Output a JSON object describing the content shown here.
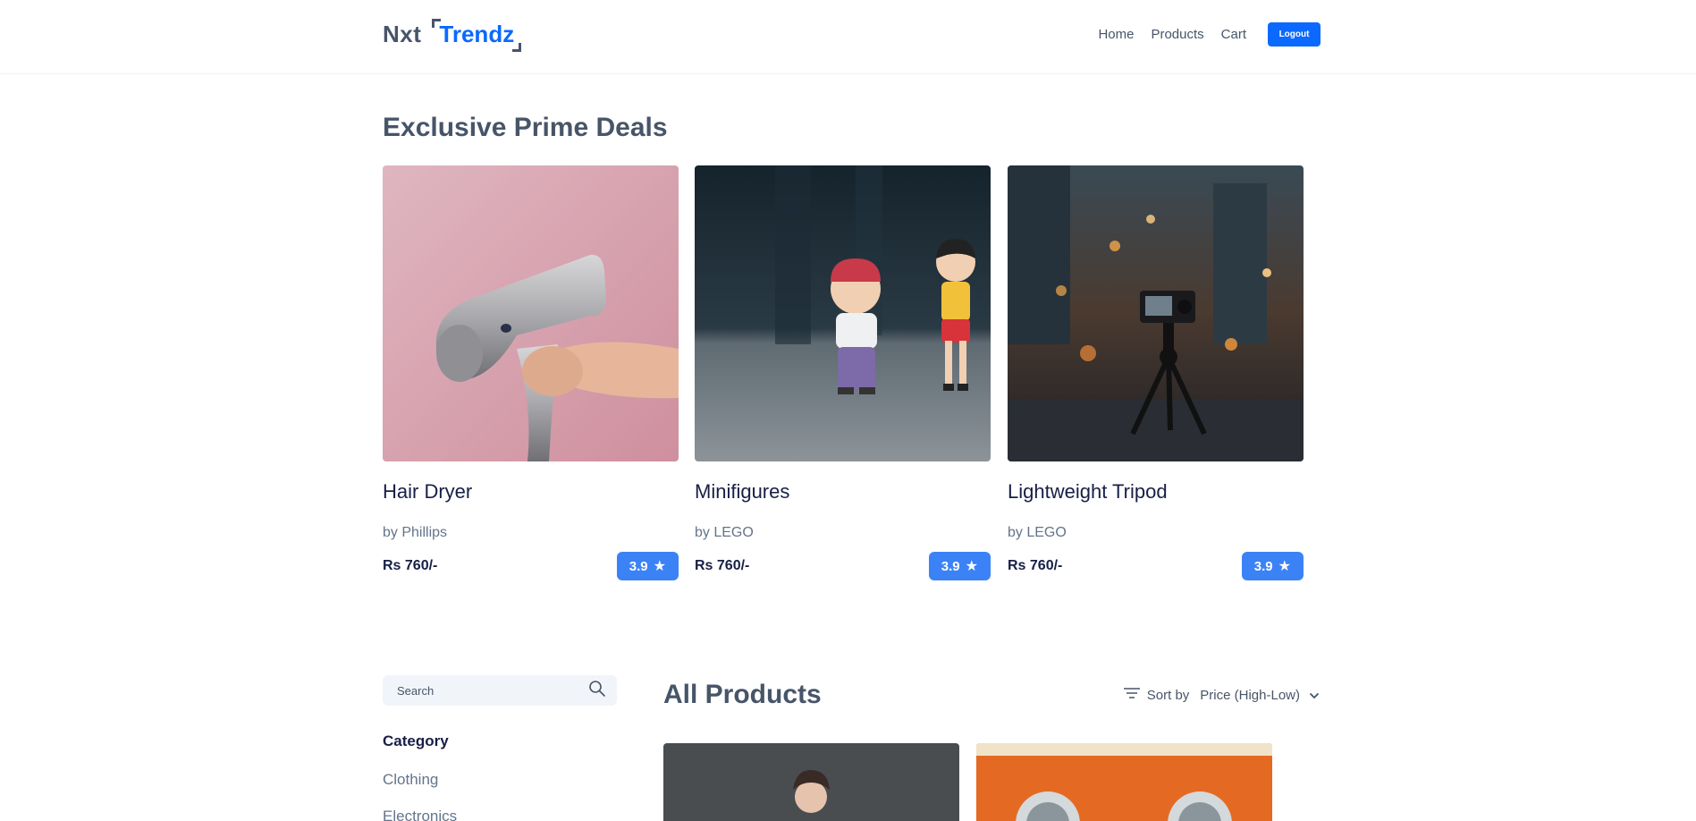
{
  "header": {
    "logo_part1": "Nxt",
    "logo_part2": "Trendz",
    "nav": [
      "Home",
      "Products",
      "Cart"
    ],
    "logout_label": "Logout"
  },
  "prime": {
    "title": "Exclusive Prime Deals",
    "deals": [
      {
        "name": "Hair Dryer",
        "brand": "by Phillips",
        "price": "Rs 760/-",
        "rating": "3.9"
      },
      {
        "name": "Minifigures",
        "brand": "by LEGO",
        "price": "Rs 760/-",
        "rating": "3.9"
      },
      {
        "name": "Lightweight Tripod",
        "brand": "by LEGO",
        "price": "Rs 760/-",
        "rating": "3.9"
      }
    ]
  },
  "filters": {
    "search_placeholder": "Search",
    "category_heading": "Category",
    "categories": [
      "Clothing",
      "Electronics"
    ]
  },
  "products": {
    "title": "All Products",
    "sort_label": "Sort by",
    "sort_value": "Price (High-Low)"
  },
  "colors": {
    "brand_blue": "#0b69ff",
    "rating_blue": "#3b82f6",
    "heading_gray": "#475569"
  },
  "icons": {
    "rating": "star-icon",
    "search": "search-icon",
    "sort": "sort-lines-icon",
    "dropdown": "chevron-down-icon"
  }
}
